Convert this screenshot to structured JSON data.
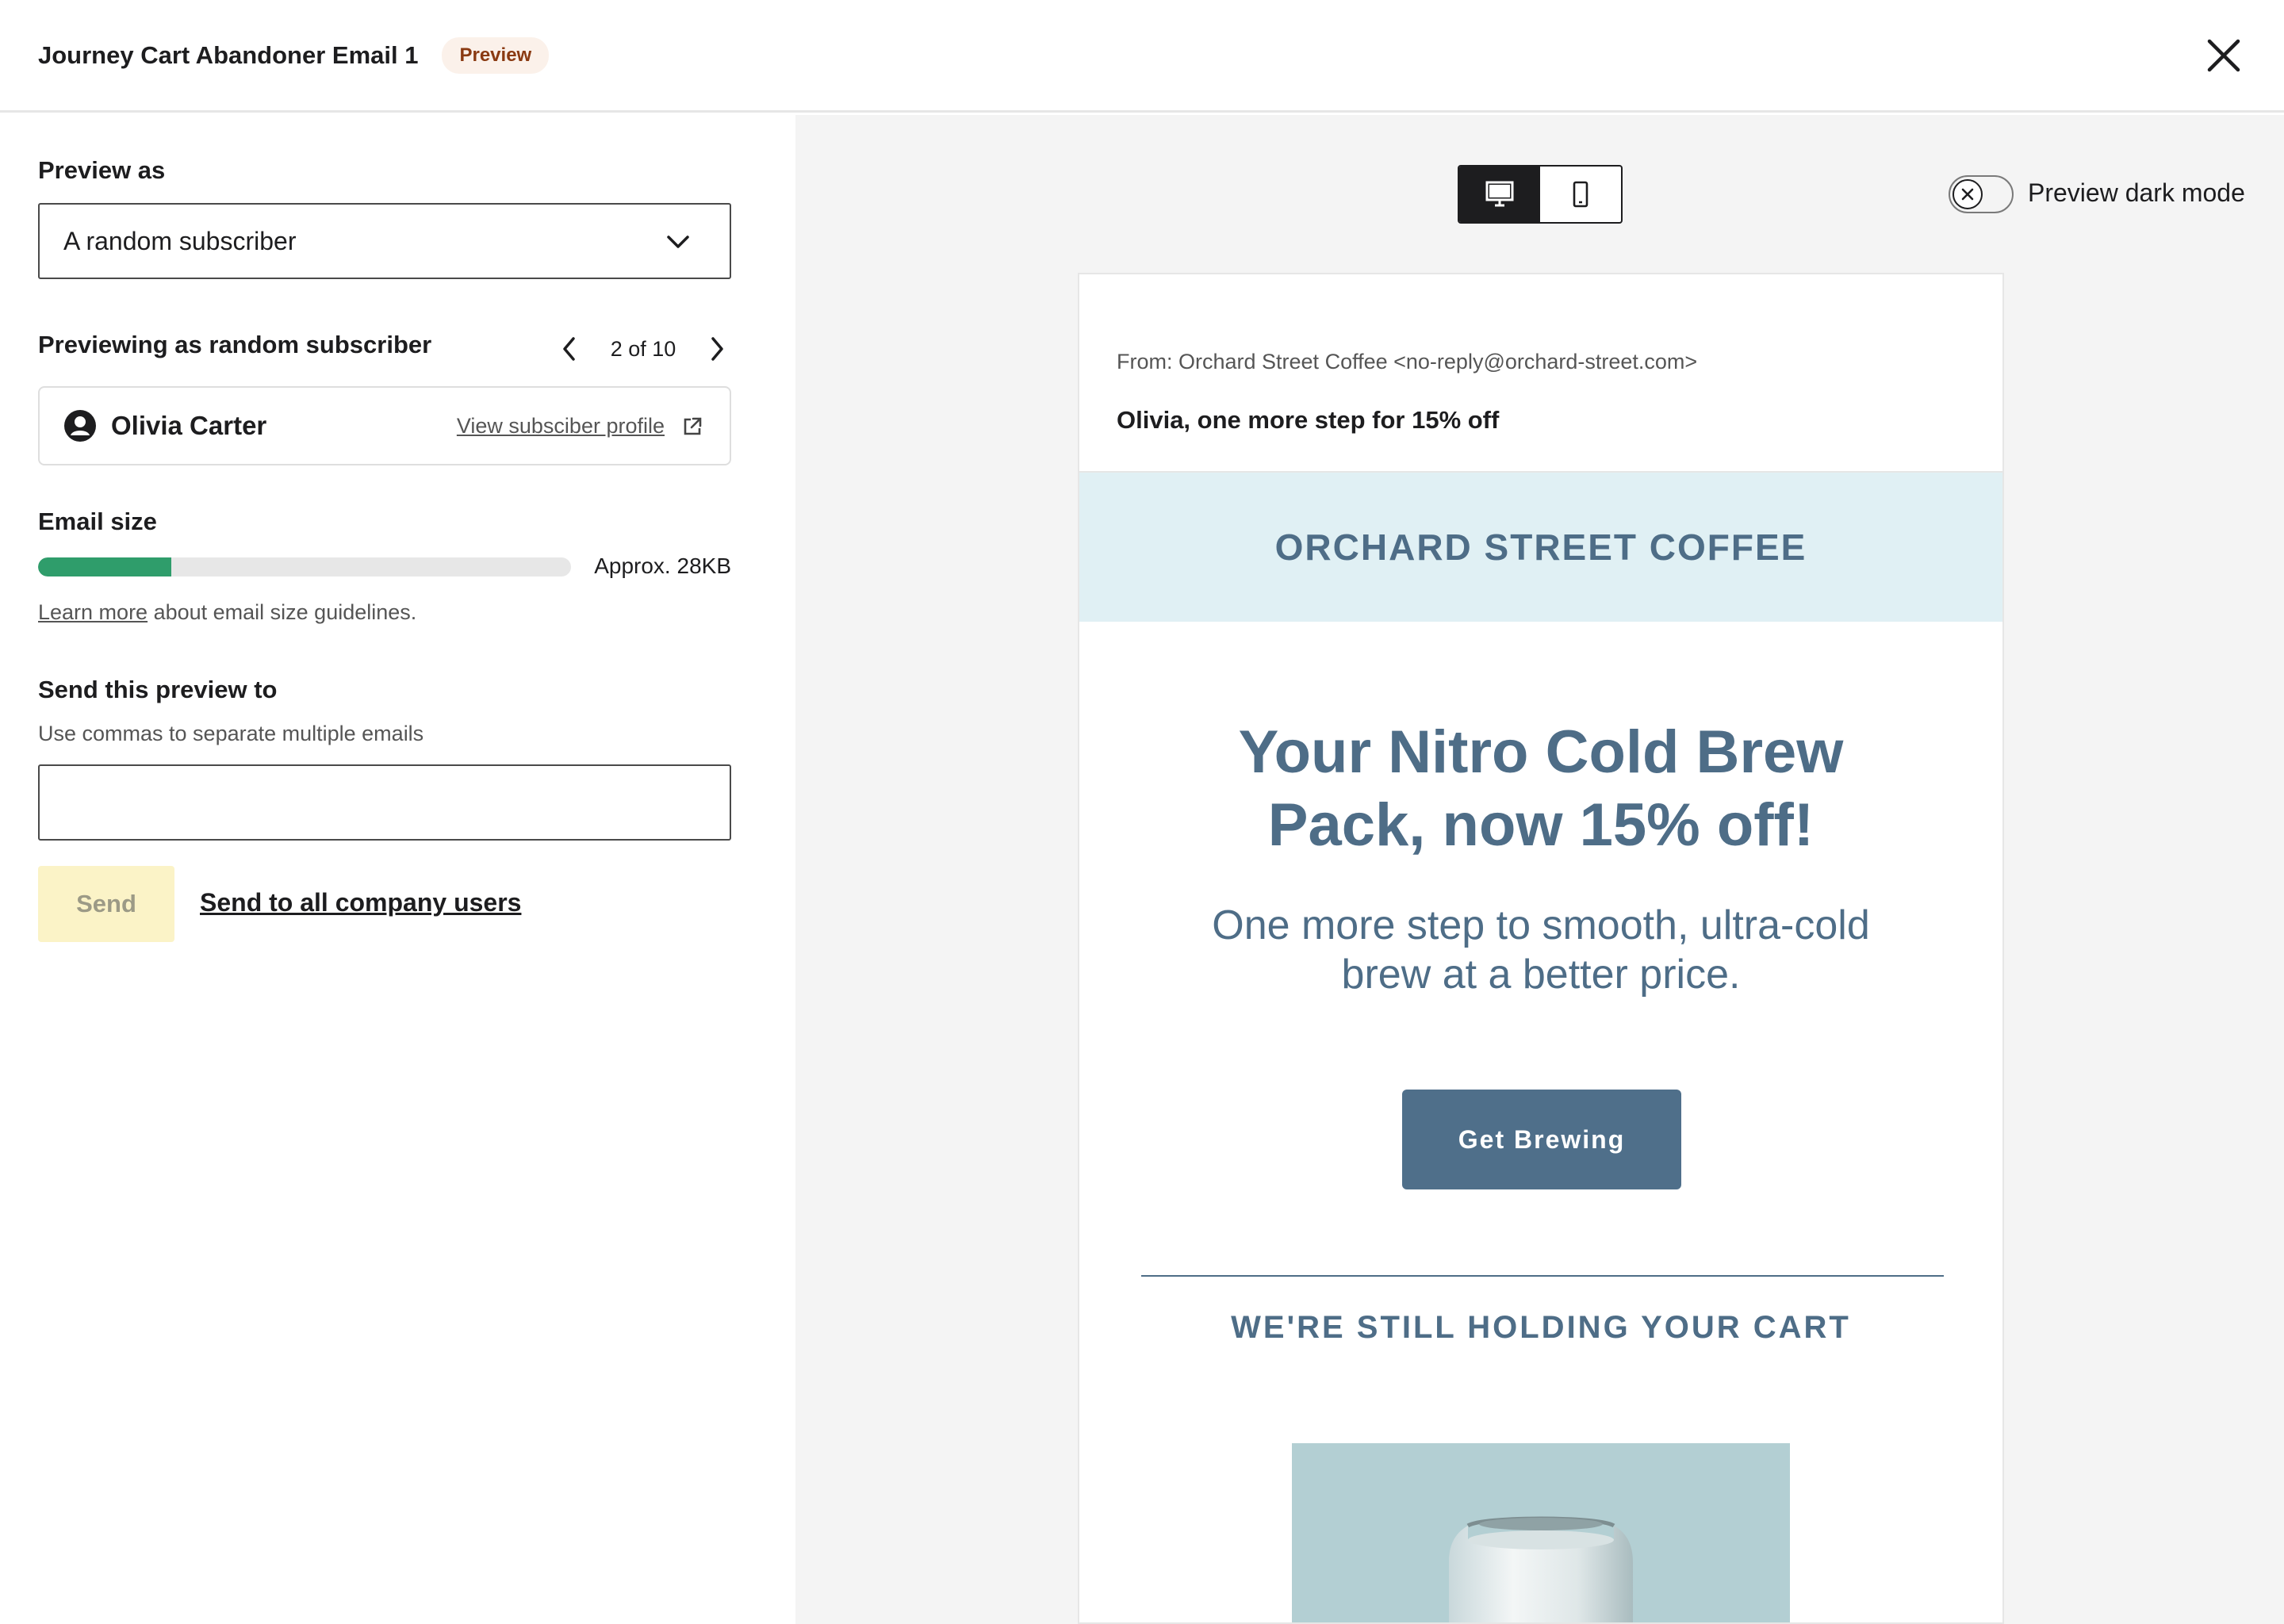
{
  "header": {
    "title": "Journey Cart Abandoner Email 1",
    "badge": "Preview"
  },
  "left": {
    "preview_as_label": "Preview as",
    "preview_as_value": "A random subscriber",
    "previewing_label": "Previewing as random subscriber",
    "pager_text": "2 of 10",
    "subscriber_name": "Olivia Carter",
    "view_profile_link": "View subsciber profile",
    "email_size_label": "Email size",
    "email_size_value": "Approx. 28KB",
    "email_size_fill_percent": 25,
    "learn_more_link": "Learn more",
    "learn_more_rest": " about email size guidelines.",
    "send_preview_label": "Send this preview to",
    "send_preview_hint": "Use commas to separate multiple emails",
    "email_input_value": "",
    "send_button": "Send",
    "send_all_link": "Send to all company users"
  },
  "right": {
    "device_options": [
      "desktop",
      "mobile"
    ],
    "device_selected": "desktop",
    "dark_mode_label": "Preview dark mode",
    "dark_mode_on": false
  },
  "email": {
    "from": "From: Orchard Street Coffee <no-reply@orchard-street.com>",
    "subject": "Olivia, one more step for 15% off",
    "brand": "ORCHARD STREET COFFEE",
    "headline_line1": "Your Nitro Cold Brew",
    "headline_line2": "Pack, now 15% off!",
    "subhead_line1": "One more step to smooth, ultra-cold",
    "subhead_line2": "brew at a better price.",
    "cta": "Get Brewing",
    "cart_title": "WE'RE STILL HOLDING YOUR CART"
  },
  "colors": {
    "accent_green": "#2f9d6b",
    "brand_blue": "#4e6d87",
    "brand_band": "#e0f0f4",
    "send_disabled_bg": "#fbf3c7",
    "badge_bg": "#fbf1ea",
    "product_bg": "#b3cfd3"
  }
}
